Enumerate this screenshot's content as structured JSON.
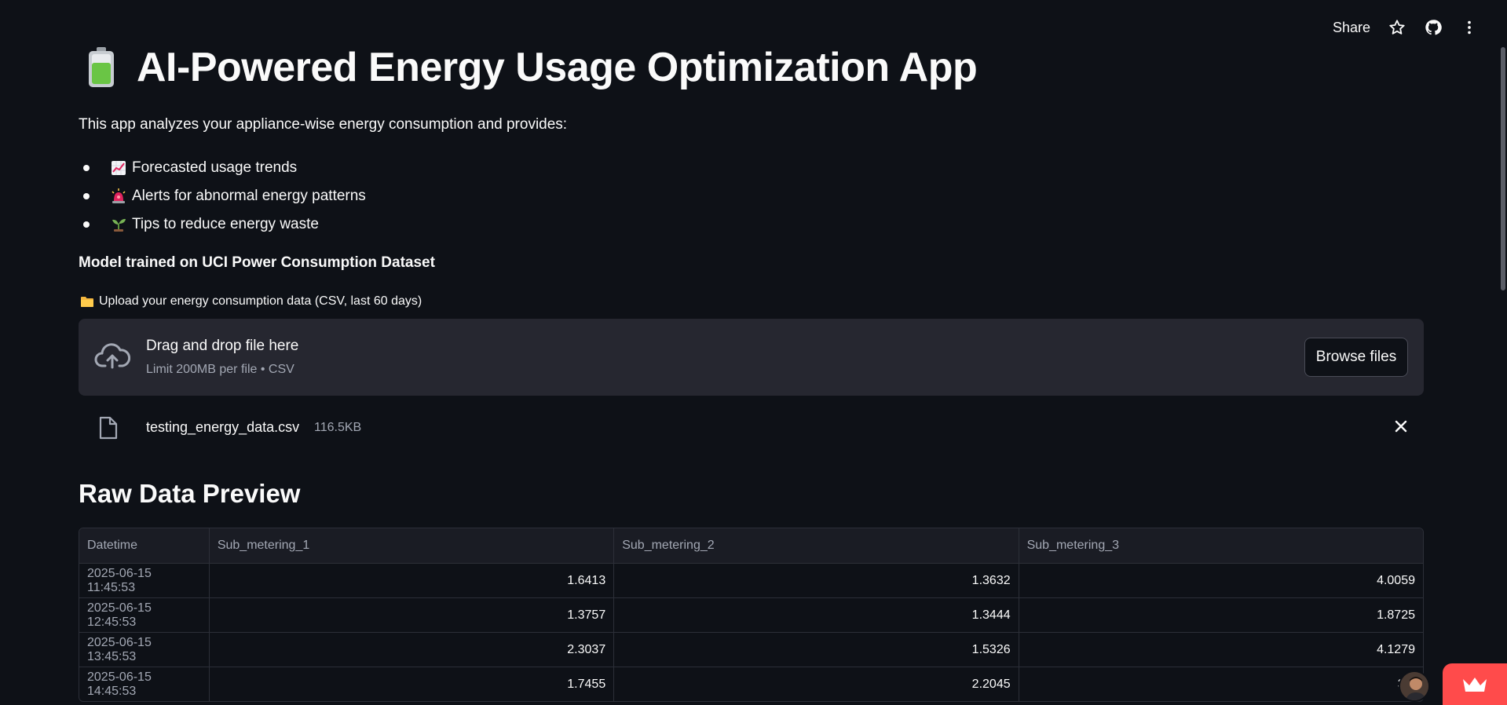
{
  "toolbar": {
    "share_label": "Share"
  },
  "header": {
    "title": "AI-Powered Energy Usage Optimization App",
    "title_icon": "battery-icon"
  },
  "intro": {
    "text": "This app analyzes your appliance-wise energy consumption and provides:"
  },
  "bullets": [
    {
      "icon": "chart-increasing-icon",
      "label": "Forecasted usage trends"
    },
    {
      "icon": "rotating-light-icon",
      "label": "Alerts for abnormal energy patterns"
    },
    {
      "icon": "seedling-icon",
      "label": "Tips to reduce energy waste"
    }
  ],
  "model_note": "Model trained on UCI Power Consumption Dataset",
  "uploader": {
    "label": "Upload your energy consumption data (CSV, last 60 days)",
    "label_icon": "folder-icon",
    "drop_title": "Drag and drop file here",
    "drop_subtitle": "Limit 200MB per file • CSV",
    "browse_label": "Browse files"
  },
  "uploaded_file": {
    "name": "testing_energy_data.csv",
    "size": "116.5KB"
  },
  "section_title": "Raw Data Preview",
  "table": {
    "columns": [
      "Datetime",
      "Sub_metering_1",
      "Sub_metering_2",
      "Sub_metering_3"
    ],
    "rows": [
      [
        "2025-06-15 11:45:53",
        "1.6413",
        "1.3632",
        "4.0059"
      ],
      [
        "2025-06-15 12:45:53",
        "1.3757",
        "1.3444",
        "1.8725"
      ],
      [
        "2025-06-15 13:45:53",
        "2.3037",
        "1.5326",
        "4.1279"
      ],
      [
        "2025-06-15 14:45:53",
        "1.7455",
        "2.2045",
        "3.1"
      ]
    ]
  },
  "colors": {
    "background": "#0e1117",
    "surface": "#262730",
    "accent": "#ff4b4b",
    "muted_text": "#a3a8b4"
  }
}
